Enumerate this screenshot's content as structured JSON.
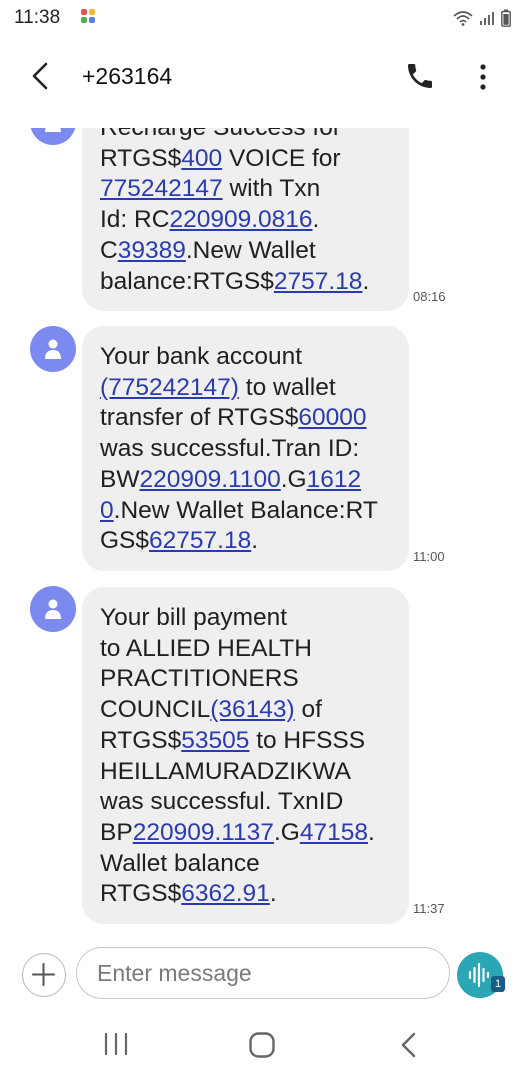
{
  "status_bar": {
    "time": "11:38",
    "icons": [
      "app-notification-icon",
      "wifi-icon",
      "signal-icon",
      "battery-icon"
    ]
  },
  "header": {
    "title": "+263164",
    "icons": [
      "back-arrow-icon",
      "phone-icon",
      "more-vert-icon"
    ]
  },
  "messages": [
    {
      "time": "08:16",
      "lines": [
        [
          {
            "t": "Recharge Success for"
          }
        ],
        [
          {
            "t": "RTGS$"
          },
          {
            "t": "400",
            "link": true
          },
          {
            "t": " VOICE for"
          }
        ],
        [
          {
            "t": "775242147",
            "link": true
          },
          {
            "t": " with Txn"
          }
        ],
        [
          {
            "t": "Id: RC"
          },
          {
            "t": "220909.0816",
            "link": true
          },
          {
            "t": "."
          }
        ],
        [
          {
            "t": "C"
          },
          {
            "t": "39389",
            "link": true
          },
          {
            "t": ".New Wallet"
          }
        ],
        [
          {
            "t": "balance:RTGS$"
          },
          {
            "t": "2757.18",
            "link": true
          },
          {
            "t": "."
          }
        ]
      ]
    },
    {
      "time": "11:00",
      "lines": [
        [
          {
            "t": "Your bank account"
          }
        ],
        [
          {
            "t": "(775242147)",
            "link": true
          },
          {
            "t": " to wallet"
          }
        ],
        [
          {
            "t": "transfer of RTGS$"
          },
          {
            "t": "60000",
            "link": true
          }
        ],
        [
          {
            "t": "was successful.Tran ID:"
          }
        ],
        [
          {
            "t": "BW"
          },
          {
            "t": "220909.1100",
            "link": true
          },
          {
            "t": ".G"
          },
          {
            "t": "1612",
            "link": true
          }
        ],
        [
          {
            "t": "0",
            "link": true
          },
          {
            "t": ".New Wallet Balance:RT"
          }
        ],
        [
          {
            "t": "GS$"
          },
          {
            "t": "62757.18",
            "link": true
          },
          {
            "t": "."
          }
        ]
      ]
    },
    {
      "time": "11:37",
      "lines": [
        [
          {
            "t": "Your bill payment"
          }
        ],
        [
          {
            "t": "to ALLIED HEALTH"
          }
        ],
        [
          {
            "t": "PRACTITIONERS"
          }
        ],
        [
          {
            "t": "COUNCIL"
          },
          {
            "t": "(36143)",
            "link": true
          },
          {
            "t": " of"
          }
        ],
        [
          {
            "t": "RTGS$"
          },
          {
            "t": "53505",
            "link": true
          },
          {
            "t": " to HFSSS"
          }
        ],
        [
          {
            "t": "HEILLAMURADZIKWA"
          }
        ],
        [
          {
            "t": "was successful. TxnID"
          }
        ],
        [
          {
            "t": "BP"
          },
          {
            "t": "220909.1137",
            "link": true
          },
          {
            "t": ".G"
          },
          {
            "t": "47158",
            "link": true
          },
          {
            "t": "."
          }
        ],
        [
          {
            "t": "Wallet balance"
          }
        ],
        [
          {
            "t": "RTGS$"
          },
          {
            "t": "6362.91",
            "link": true
          },
          {
            "t": "."
          }
        ]
      ]
    }
  ],
  "composer": {
    "placeholder": "Enter message",
    "value": "",
    "sim_badge": "1",
    "icons": [
      "add-icon",
      "voice-wave-icon"
    ]
  },
  "nav_bar": {
    "icons": [
      "recents-icon",
      "home-icon",
      "back-icon"
    ]
  },
  "colors": {
    "bubble_bg": "#efefef",
    "link": "#2a3bb0",
    "avatar": "#7c8af0",
    "voice_button": "#2aa6b5",
    "sim_badge": "#1b5c86"
  }
}
